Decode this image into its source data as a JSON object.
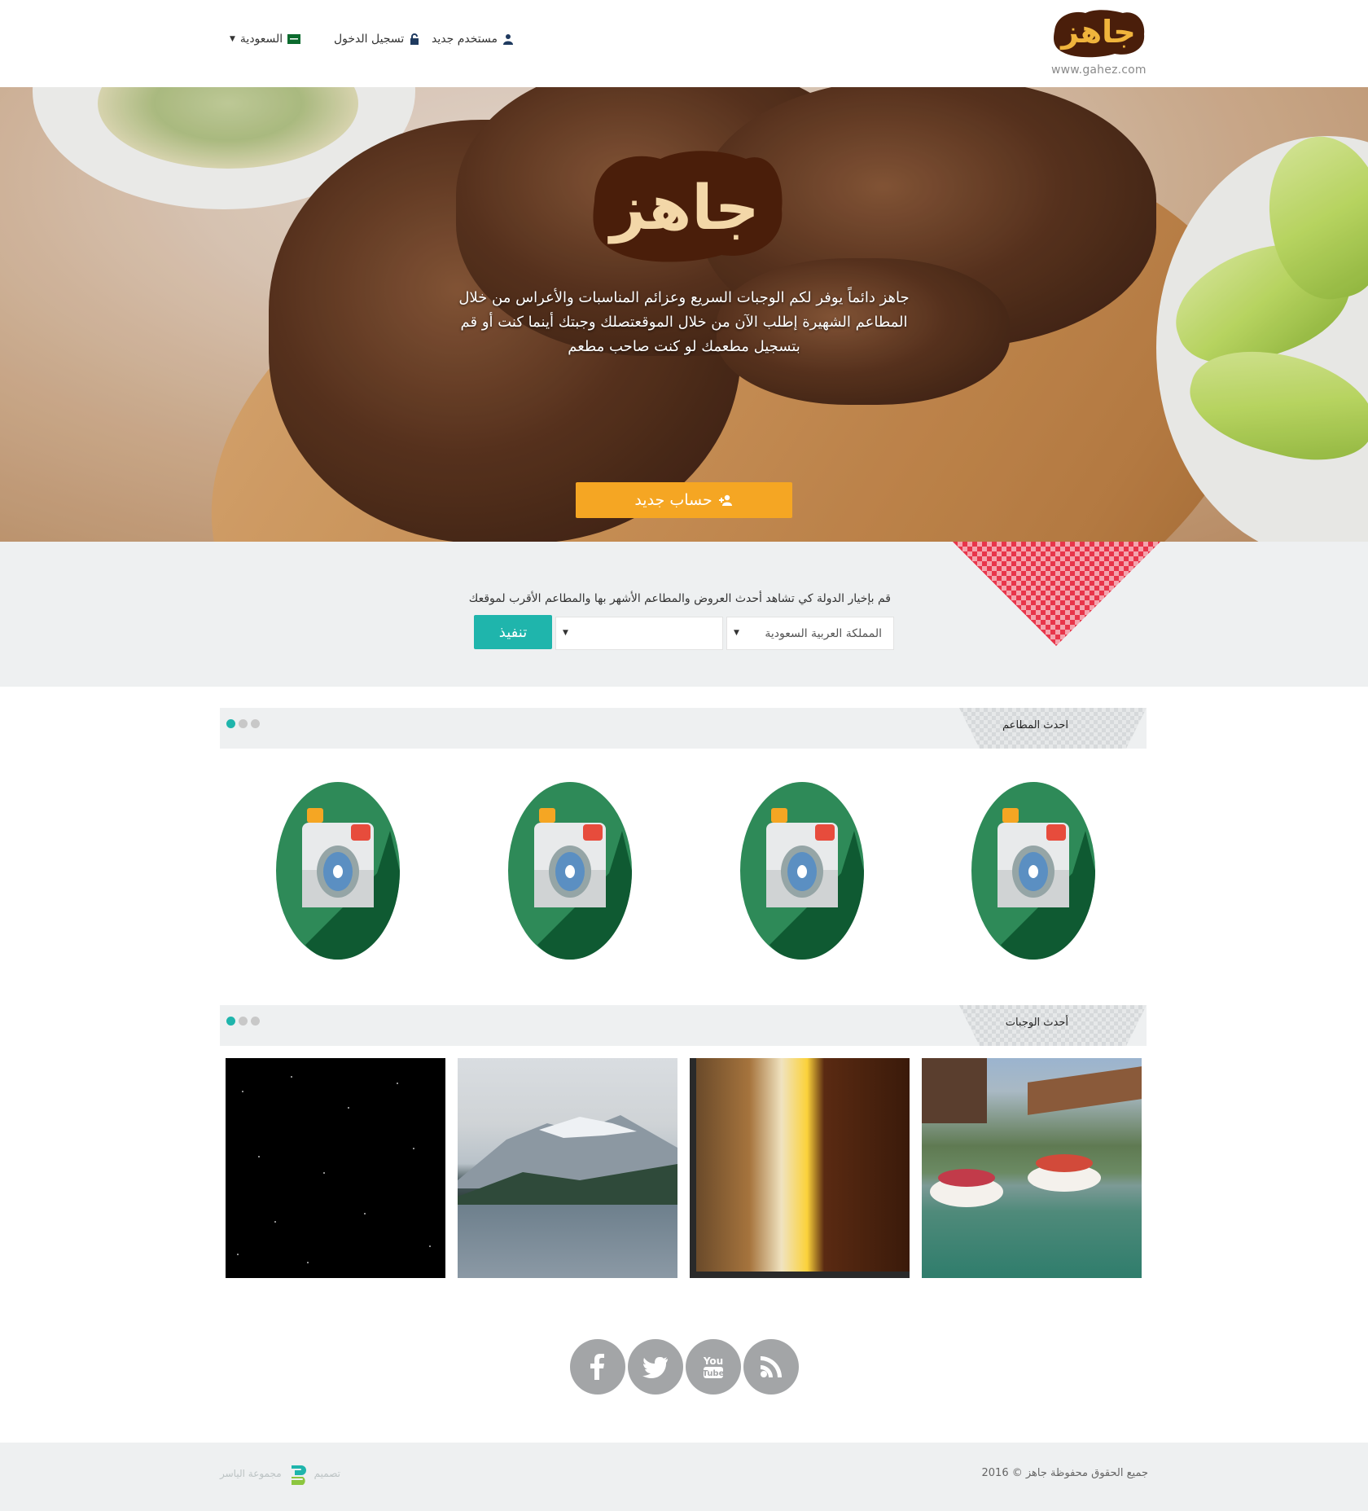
{
  "header": {
    "logo_text": "جاهز",
    "logo_url": "www.gahez.com",
    "nav": {
      "new_user": "مستخدم جديد",
      "login": "تسجيل الدخول",
      "country": "السعودية"
    }
  },
  "hero": {
    "logo_text": "جاهز",
    "description": "جاهز دائماً يوفر لكم الوجبات السريع وعزائم المناسبات والأعراس من خلال المطاعم الشهيرة إطلب الآن من خلال الموقعتصلك وجبتك أينما كنت أو قم بتسجيل مطعمك لو كنت صاحب مطعم",
    "cta_label": "حساب جديد"
  },
  "country_filter": {
    "label": "قم بإخيار الدولة كي تشاهد أحدث العروض والمطاعم الأشهر بها والمطاعم الأقرب لموقعك",
    "country_value": "المملكة العربية السعودية",
    "city_value": "",
    "submit_label": "تنفيذ"
  },
  "sections": {
    "restaurants_title": "احدث المطاعم",
    "meals_title": "أحدث الوجبات"
  },
  "restaurants": [
    {
      "icon": "camera-icon"
    },
    {
      "icon": "camera-icon"
    },
    {
      "icon": "camera-icon"
    },
    {
      "icon": "camera-icon"
    }
  ],
  "social": [
    "facebook-icon",
    "twitter-icon",
    "youtube-icon",
    "rss-icon"
  ],
  "footer": {
    "copyright": "جميع الحقوق محفوظة جاهز © 2016",
    "design_prefix": "تصميم",
    "designer_name": "مجموعة الياسر"
  },
  "colors": {
    "accent_orange": "#f5a623",
    "accent_teal": "#1fb5ac",
    "logo_brown": "#4a1e0a",
    "logo_gold": "#f0b43c",
    "camera_green": "#2e8a58"
  }
}
